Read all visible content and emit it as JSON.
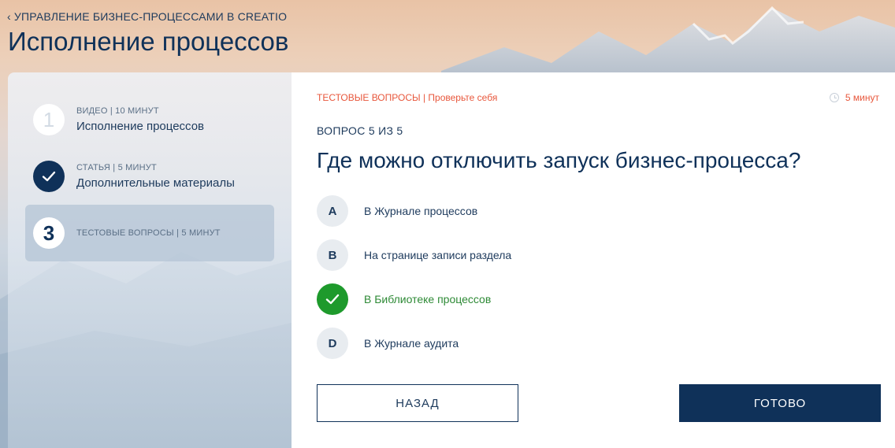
{
  "header": {
    "breadcrumb": "УПРАВЛЕНИЕ БИЗНЕС-ПРОЦЕССАМИ В CREATIO",
    "title": "Исполнение процессов"
  },
  "steps": [
    {
      "number": "1",
      "meta": "ВИДЕО | 10 МИНУТ",
      "name": "Исполнение процессов",
      "state": "pending"
    },
    {
      "number": "",
      "meta": "СТАТЬЯ | 5 МИНУТ",
      "name": "Дополнительные материалы",
      "state": "done"
    },
    {
      "number": "3",
      "meta": "ТЕСТОВЫЕ ВОПРОСЫ | 5 МИНУТ",
      "name": "",
      "state": "active"
    }
  ],
  "quiz": {
    "section": "ТЕСТОВЫЕ ВОПРОСЫ",
    "section_sub": "| Проверьте себя",
    "duration": "5 минут",
    "counter": "ВОПРОС 5 ИЗ 5",
    "question": "Где можно отключить запуск бизнес-процесса?",
    "answers": [
      {
        "letter": "A",
        "text": "В Журнале процессов",
        "correct": false
      },
      {
        "letter": "B",
        "text": "На странице записи раздела",
        "correct": false
      },
      {
        "letter": "",
        "text": "В Библиотеке процессов",
        "correct": true
      },
      {
        "letter": "D",
        "text": "В Журнале аудита",
        "correct": false
      }
    ],
    "back_label": "НАЗАД",
    "done_label": "ГОТОВО"
  },
  "colors": {
    "navy": "#0f3159",
    "accent": "#e8573c",
    "correct": "#1e9a2c"
  },
  "icons": [
    "chevron-left-icon",
    "check-icon",
    "clock-icon"
  ]
}
